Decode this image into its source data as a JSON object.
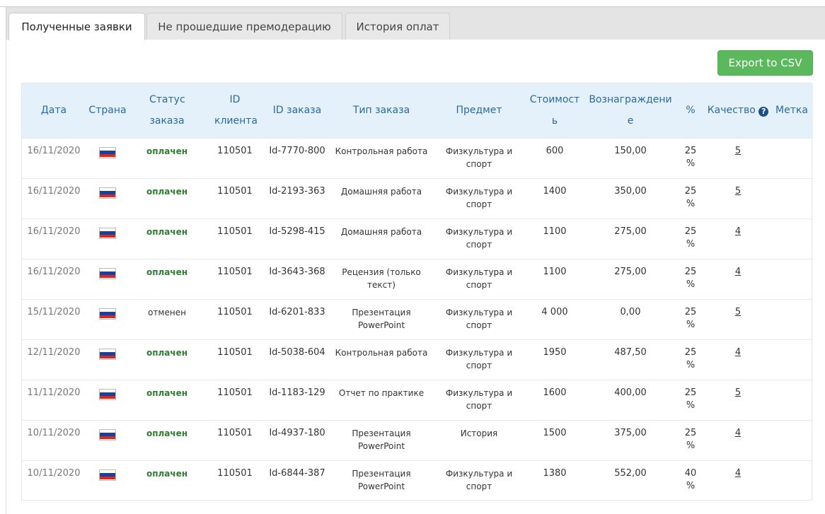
{
  "tabs": [
    {
      "label": "Полученные заявки",
      "active": true
    },
    {
      "label": "Не прошедшие премодерацию",
      "active": false
    },
    {
      "label": "История оплат",
      "active": false
    }
  ],
  "toolbar": {
    "export_label": "Export to CSV"
  },
  "table": {
    "headers": [
      "Дата",
      "Страна",
      "Статус заказа",
      "ID клиента",
      "ID заказа",
      "Тип заказа",
      "Предмет",
      "Стоимость",
      "Вознаграждение",
      "%",
      "Качество",
      "Метка"
    ],
    "rows": [
      {
        "date": "16/11/2020",
        "status": "оплачен",
        "client_id": "110501",
        "order_id": "Id-7770-800",
        "type": "Контрольная работа",
        "subject": "Физкультура и спорт",
        "price": "600",
        "reward": "150,00",
        "percent": "25 %",
        "quality": "5",
        "tag": ""
      },
      {
        "date": "16/11/2020",
        "status": "оплачен",
        "client_id": "110501",
        "order_id": "Id-2193-363",
        "type": "Домашняя работа",
        "subject": "Физкультура и спорт",
        "price": "1400",
        "reward": "350,00",
        "percent": "25 %",
        "quality": "5",
        "tag": ""
      },
      {
        "date": "16/11/2020",
        "status": "оплачен",
        "client_id": "110501",
        "order_id": "Id-5298-415",
        "type": "Домашняя работа",
        "subject": "Физкультура и спорт",
        "price": "1100",
        "reward": "275,00",
        "percent": "25 %",
        "quality": "4",
        "tag": ""
      },
      {
        "date": "16/11/2020",
        "status": "оплачен",
        "client_id": "110501",
        "order_id": "Id-3643-368",
        "type": "Рецензия (только текст)",
        "subject": "Физкультура и спорт",
        "price": "1100",
        "reward": "275,00",
        "percent": "25 %",
        "quality": "4",
        "tag": ""
      },
      {
        "date": "15/11/2020",
        "status": "отменен",
        "client_id": "110501",
        "order_id": "Id-6201-833",
        "type": "Презентация PowerPoint",
        "subject": "Физкультура и спорт",
        "price": "4 000",
        "reward": "0,00",
        "percent": "25 %",
        "quality": "5",
        "tag": ""
      },
      {
        "date": "12/11/2020",
        "status": "оплачен",
        "client_id": "110501",
        "order_id": "Id-5038-604",
        "type": "Контрольная работа",
        "subject": "Физкультура и спорт",
        "price": "1950",
        "reward": "487,50",
        "percent": "25 %",
        "quality": "4",
        "tag": ""
      },
      {
        "date": "11/11/2020",
        "status": "оплачен",
        "client_id": "110501",
        "order_id": "Id-1183-129",
        "type": "Отчет по практике",
        "subject": "Физкультура и спорт",
        "price": "1600",
        "reward": "400,00",
        "percent": "25 %",
        "quality": "5",
        "tag": ""
      },
      {
        "date": "10/11/2020",
        "status": "оплачен",
        "client_id": "110501",
        "order_id": "Id-4937-180",
        "type": "Презентация PowerPoint",
        "subject": "История",
        "price": "1500",
        "reward": "375,00",
        "percent": "25 %",
        "quality": "4",
        "tag": ""
      },
      {
        "date": "10/11/2020",
        "status": "оплачен",
        "client_id": "110501",
        "order_id": "Id-6844-387",
        "type": "Презентация PowerPoint",
        "subject": "Физкультура и спорт",
        "price": "1380",
        "reward": "552,00",
        "percent": "40 %",
        "quality": "4",
        "tag": ""
      }
    ]
  },
  "icons": {
    "flag": "russia-flag-icon",
    "help": "question-circle-icon"
  },
  "colors": {
    "accent": "#5cb85c",
    "header_bg": "#e4f1fb",
    "header_text": "#2a6aa0",
    "paid": "#2e7d32"
  }
}
